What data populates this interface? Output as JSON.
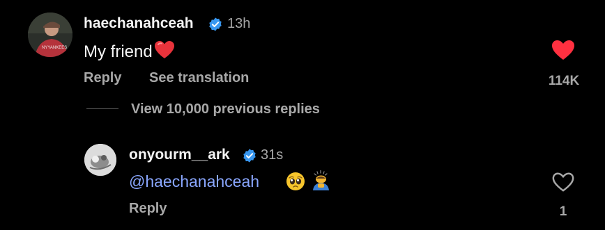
{
  "comment": {
    "username": "haechanahceah",
    "time": "13h",
    "text": "My friend",
    "reply_label": "Reply",
    "translate_label": "See translation",
    "like_count": "114K",
    "liked": true,
    "avatar_shirt_text": "NYYANKEES"
  },
  "view_replies": {
    "label": "View 10,000 previous replies"
  },
  "reply": {
    "username": "onyourm__ark",
    "time": "31s",
    "mention": "@haechanahceah",
    "reply_label": "Reply",
    "like_count": "1",
    "liked": false
  },
  "colors": {
    "background": "#000000",
    "primary_text": "#f5f5f5",
    "secondary_text": "#a8a8a8",
    "verified_blue": "#3897f0",
    "like_red": "#ff3040",
    "mention_blue": "#8aa7ff"
  },
  "icons": {
    "verified": "verified-badge-icon",
    "like_filled": "heart-filled-icon",
    "like_outline": "heart-outline-icon",
    "emoji_inline": "red-heart-emoji",
    "emoji_pleading": "pleading-face-emoji",
    "emoji_bow": "person-bowing-emoji"
  }
}
